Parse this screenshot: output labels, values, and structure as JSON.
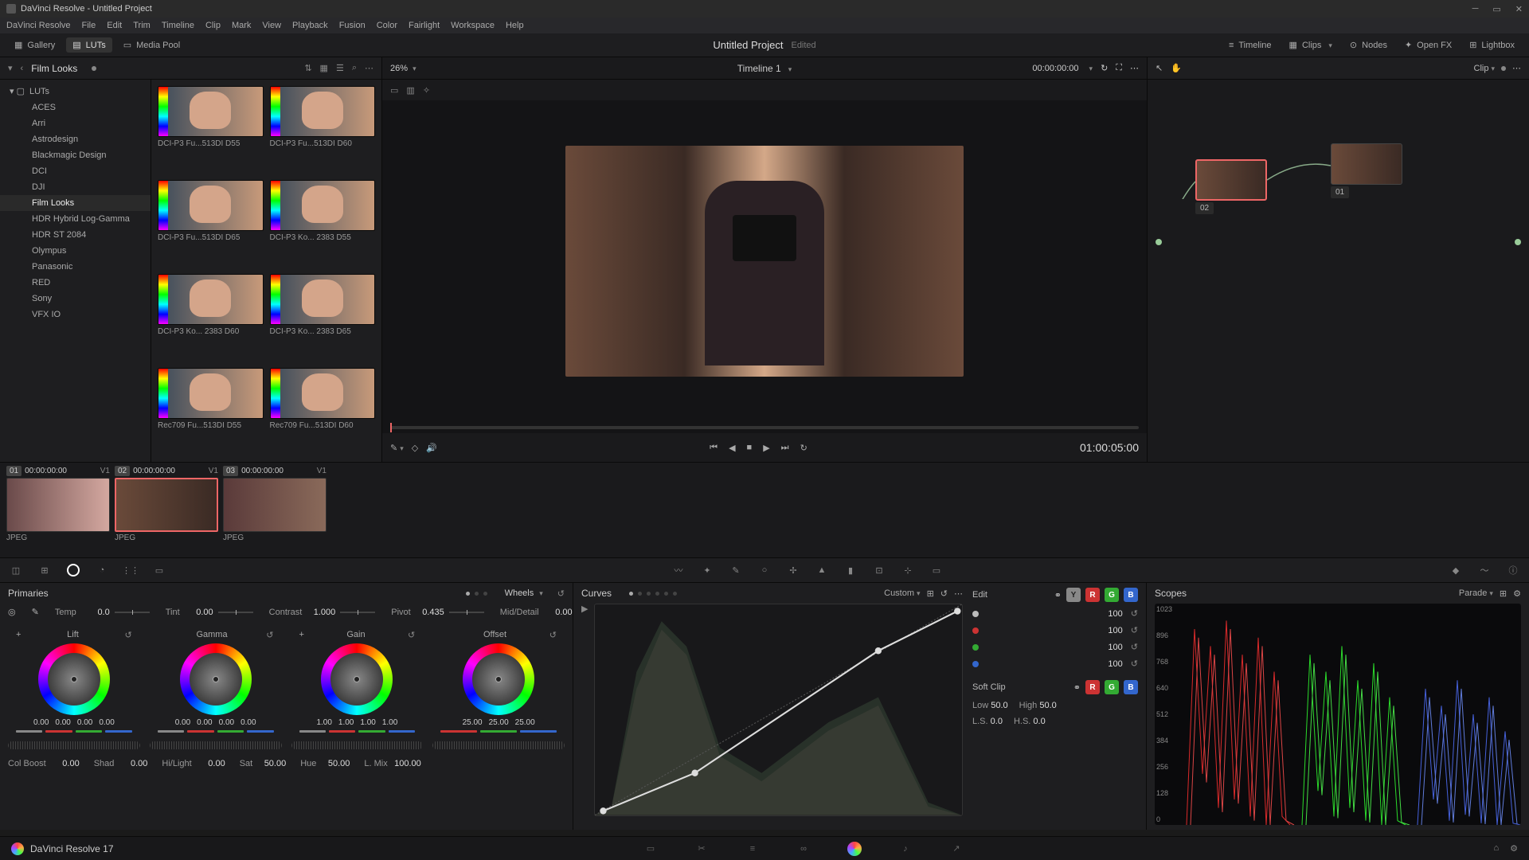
{
  "app": {
    "title": "DaVinci Resolve - Untitled Project"
  },
  "menu": [
    "DaVinci Resolve",
    "File",
    "Edit",
    "Trim",
    "Timeline",
    "Clip",
    "Mark",
    "View",
    "Playback",
    "Fusion",
    "Color",
    "Fairlight",
    "Workspace",
    "Help"
  ],
  "toolbar": {
    "gallery": "Gallery",
    "luts": "LUTs",
    "media_pool": "Media Pool",
    "project": "Untitled Project",
    "edited": "Edited",
    "timeline": "Timeline",
    "clips": "Clips",
    "nodes": "Nodes",
    "openfx": "Open FX",
    "lightbox": "Lightbox"
  },
  "lut": {
    "crumb": "Film Looks",
    "root": "LUTs",
    "categories": [
      "ACES",
      "Arri",
      "Astrodesign",
      "Blackmagic Design",
      "DCI",
      "DJI",
      "Film Looks",
      "HDR Hybrid Log-Gamma",
      "HDR ST 2084",
      "Olympus",
      "Panasonic",
      "RED",
      "Sony",
      "VFX IO"
    ],
    "selected": "Film Looks",
    "thumbs": [
      "DCI-P3 Fu...513DI D55",
      "DCI-P3 Fu...513DI D60",
      "DCI-P3 Fu...513DI D65",
      "DCI-P3 Ko... 2383 D55",
      "DCI-P3 Ko... 2383 D60",
      "DCI-P3 Ko... 2383 D65",
      "Rec709 Fu...513DI D55",
      "Rec709 Fu...513DI D60"
    ]
  },
  "viewer": {
    "zoom": "26%",
    "timeline_name": "Timeline 1",
    "tc_in": "00:00:00:00",
    "tc_out": "01:00:05:00"
  },
  "nodes_panel": {
    "mode": "Clip",
    "nodes": [
      {
        "id": "02",
        "selected": true
      },
      {
        "id": "01",
        "selected": false
      }
    ]
  },
  "clips": [
    {
      "num": "01",
      "tc": "00:00:00:00",
      "track": "V1",
      "label": "JPEG",
      "selected": false
    },
    {
      "num": "02",
      "tc": "00:00:00:00",
      "track": "V1",
      "label": "JPEG",
      "selected": true
    },
    {
      "num": "03",
      "tc": "00:00:00:00",
      "track": "V1",
      "label": "JPEG",
      "selected": false
    }
  ],
  "primaries": {
    "title": "Primaries",
    "mode": "Wheels",
    "adjust": {
      "temp": "0.0",
      "tint": "0.00",
      "contrast": "1.000",
      "pivot": "0.435",
      "mid": "0.00"
    },
    "labels": {
      "temp": "Temp",
      "tint": "Tint",
      "contrast": "Contrast",
      "pivot": "Pivot",
      "mid": "Mid/Detail"
    },
    "wheels": [
      {
        "name": "Lift",
        "vals": [
          "0.00",
          "0.00",
          "0.00",
          "0.00"
        ]
      },
      {
        "name": "Gamma",
        "vals": [
          "0.00",
          "0.00",
          "0.00",
          "0.00"
        ]
      },
      {
        "name": "Gain",
        "vals": [
          "1.00",
          "1.00",
          "1.00",
          "1.00"
        ]
      },
      {
        "name": "Offset",
        "vals": [
          "25.00",
          "25.00",
          "25.00"
        ]
      }
    ],
    "bottom_labels": {
      "colboost": "Col Boost",
      "shad": "Shad",
      "hl": "Hi/Light",
      "sat": "Sat",
      "hue": "Hue",
      "lmix": "L. Mix"
    },
    "bottom": {
      "colboost": "0.00",
      "shad": "0.00",
      "hl": "0.00",
      "sat": "50.00",
      "hue": "50.00",
      "lmix": "100.00"
    }
  },
  "curves": {
    "title": "Curves",
    "mode": "Custom",
    "edit": "Edit",
    "channels": [
      {
        "color": "#bbbbbb",
        "val": "100"
      },
      {
        "color": "#cc3333",
        "val": "100"
      },
      {
        "color": "#33aa33",
        "val": "100"
      },
      {
        "color": "#3366cc",
        "val": "100"
      }
    ],
    "softclip": "Soft Clip",
    "low_label": "Low",
    "low": "50.0",
    "high_label": "High",
    "high": "50.0",
    "ls_label": "L.S.",
    "ls": "0.0",
    "hs_label": "H.S.",
    "hs": "0.0"
  },
  "scopes": {
    "title": "Scopes",
    "mode": "Parade",
    "yticks": [
      "1023",
      "896",
      "768",
      "640",
      "512",
      "384",
      "256",
      "128",
      "0"
    ]
  },
  "pagebar": {
    "version": "DaVinci Resolve 17"
  }
}
